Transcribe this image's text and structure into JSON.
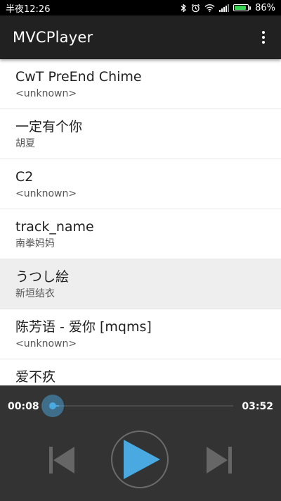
{
  "status_bar": {
    "time": "半夜12:26",
    "battery_percent": "86%",
    "battery_level": 0.86,
    "icons": [
      "bluetooth-icon",
      "alarm-icon",
      "wifi-icon",
      "signal-icon",
      "battery-icon"
    ]
  },
  "app_bar": {
    "title": "MVCPlayer",
    "overflow_icon": "more-vert-icon"
  },
  "tracks": [
    {
      "title": "CwT PreEnd Chime",
      "artist": "<unknown>"
    },
    {
      "title": "一定有个你",
      "artist": "胡夏"
    },
    {
      "title": "C2",
      "artist": "<unknown>"
    },
    {
      "title": "track_name",
      "artist": "南拳妈妈"
    },
    {
      "title": "うつし絵",
      "artist": "新垣结衣"
    },
    {
      "title": "陈芳语 - 爱你 [mqms]",
      "artist": "<unknown>"
    },
    {
      "title": "爱不疚",
      "artist": ""
    }
  ],
  "selected_track_index": 4,
  "player": {
    "elapsed": "00:08",
    "duration": "03:52",
    "progress": 0.034,
    "controls": [
      "previous-icon",
      "play-icon",
      "next-icon"
    ]
  },
  "colors": {
    "status_bar_bg": "#000000",
    "app_bar_bg": "#212121",
    "player_bg": "#333333",
    "accent": "#4aa9e0",
    "selected_row_bg": "#eeeeee",
    "battery_green": "#39d353"
  }
}
